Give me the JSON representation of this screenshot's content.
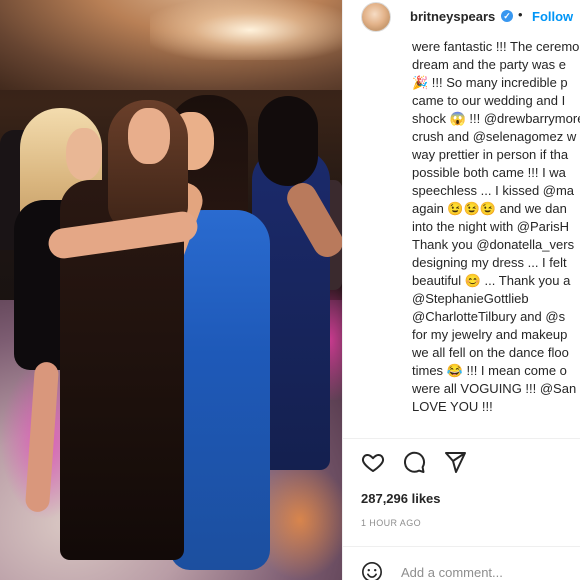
{
  "post": {
    "photo_alt_icon": "post-photo",
    "author": {
      "username": "britneyspears",
      "verified_icon": "verified-badge-icon",
      "verified_glyph": "✓",
      "separator": "•",
      "follow_label": "Follow"
    },
    "caption_lines": [
      "were fantastic !!! The ceremony",
      "dream and the party was e",
      "🎉 !!! So many incredible p",
      "came to our wedding and I",
      "shock 😱 !!! @drewbarrymore",
      "crush and @selenagomez w",
      "way prettier in person if tha",
      "possible both came !!! I wa",
      "speechless ... I kissed @ma",
      "again 😉😉😉 and we dan",
      "into the night with @ParisH",
      "Thank you @donatella_vers",
      "designing my dress ... I felt",
      "beautiful 😊 ... Thank you a",
      "@StephanieGottlieb",
      "@CharlotteTilbury and @s",
      "for my jewelry and makeup",
      "we all fell on the dance floo",
      "times 😂 !!! I mean come o",
      "were all VOGUING !!! @San",
      "LOVE YOU !!!"
    ],
    "actions": {
      "like_icon": "heart-icon",
      "comment_icon": "comment-icon",
      "share_icon": "share-icon"
    },
    "likes_text": "287,296 likes",
    "timestamp": "1 HOUR AGO",
    "comment_box": {
      "emoji_icon": "emoji-icon",
      "placeholder": "Add a comment..."
    }
  },
  "colors": {
    "accent": "#0095f6",
    "verified": "#3897f0",
    "text": "#262626",
    "muted": "#8e8e8e"
  }
}
